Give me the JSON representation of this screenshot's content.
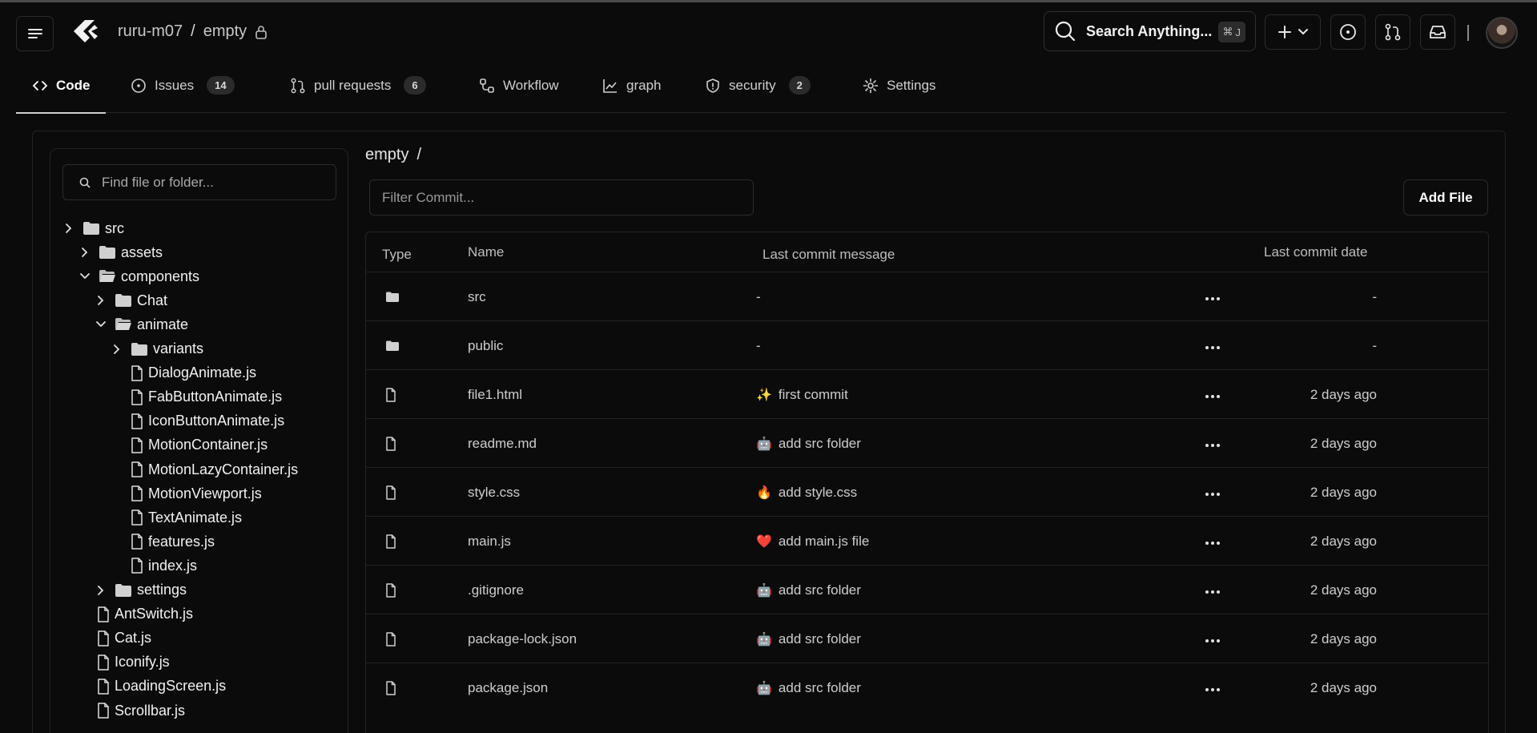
{
  "header": {
    "owner": "ruru-m07",
    "separator": "/",
    "repo": "empty",
    "search_label": "Search Anything...",
    "search_shortcut_symbol": "⌘",
    "search_shortcut_key": "J"
  },
  "tabs": [
    {
      "label": "Code",
      "count": null,
      "icon": "code-icon"
    },
    {
      "label": "Issues",
      "count": "14",
      "icon": "issue-icon"
    },
    {
      "label": "pull requests",
      "count": "6",
      "icon": "pull-request-icon"
    },
    {
      "label": "Workflow",
      "count": null,
      "icon": "workflow-icon"
    },
    {
      "label": "graph",
      "count": null,
      "icon": "graph-icon"
    },
    {
      "label": "security",
      "count": "2",
      "icon": "shield-icon"
    },
    {
      "label": "Settings",
      "count": null,
      "icon": "gear-icon"
    }
  ],
  "sidebar": {
    "find_placeholder": "Find file or folder...",
    "tree": [
      {
        "name": "src",
        "type": "folder",
        "state": "collapsed"
      },
      {
        "name": "assets",
        "type": "folder",
        "state": "collapsed"
      },
      {
        "name": "components",
        "type": "folder",
        "state": "expanded"
      },
      {
        "name": "Chat",
        "type": "folder",
        "state": "collapsed"
      },
      {
        "name": "animate",
        "type": "folder",
        "state": "expanded"
      },
      {
        "name": "variants",
        "type": "folder",
        "state": "collapsed"
      },
      {
        "name": "DialogAnimate.js",
        "type": "file"
      },
      {
        "name": "FabButtonAnimate.js",
        "type": "file"
      },
      {
        "name": "IconButtonAnimate.js",
        "type": "file"
      },
      {
        "name": "MotionContainer.js",
        "type": "file"
      },
      {
        "name": "MotionLazyContainer.js",
        "type": "file"
      },
      {
        "name": "MotionViewport.js",
        "type": "file"
      },
      {
        "name": "TextAnimate.js",
        "type": "file"
      },
      {
        "name": "features.js",
        "type": "file"
      },
      {
        "name": "index.js",
        "type": "file"
      },
      {
        "name": "settings",
        "type": "folder",
        "state": "collapsed"
      },
      {
        "name": "AntSwitch.js",
        "type": "file"
      },
      {
        "name": "Cat.js",
        "type": "file"
      },
      {
        "name": "Iconify.js",
        "type": "file"
      },
      {
        "name": "LoadingScreen.js",
        "type": "file"
      },
      {
        "name": "Scrollbar.js",
        "type": "file"
      }
    ]
  },
  "content": {
    "breadcrumb_repo": "empty",
    "breadcrumb_sep": "/",
    "filter_placeholder": "Filter Commit...",
    "add_file_label": "Add File",
    "columns": {
      "type": "Type",
      "name": "Name",
      "message": "Last commit message",
      "date": "Last commit date"
    },
    "rows": [
      {
        "type": "folder",
        "name": "src",
        "emoji": "",
        "message": "-",
        "date": "-"
      },
      {
        "type": "folder",
        "name": "public",
        "emoji": "",
        "message": "-",
        "date": "-"
      },
      {
        "type": "file",
        "name": "file1.html",
        "emoji": "✨",
        "message": "first commit",
        "date": "2 days ago"
      },
      {
        "type": "file",
        "name": "readme.md",
        "emoji": "🤖",
        "message": "add src folder",
        "date": "2 days ago"
      },
      {
        "type": "file",
        "name": "style.css",
        "emoji": "🔥",
        "message": "add style.css",
        "date": "2 days ago"
      },
      {
        "type": "file",
        "name": "main.js",
        "emoji": "❤️",
        "message": "add main.js file",
        "date": "2 days ago"
      },
      {
        "type": "file",
        "name": ".gitignore",
        "emoji": "🤖",
        "message": "add src folder",
        "date": "2 days ago"
      },
      {
        "type": "file",
        "name": "package-lock.json",
        "emoji": "🤖",
        "message": "add src folder",
        "date": "2 days ago"
      },
      {
        "type": "file",
        "name": "package.json",
        "emoji": "🤖",
        "message": "add src folder",
        "date": "2 days ago"
      }
    ]
  }
}
